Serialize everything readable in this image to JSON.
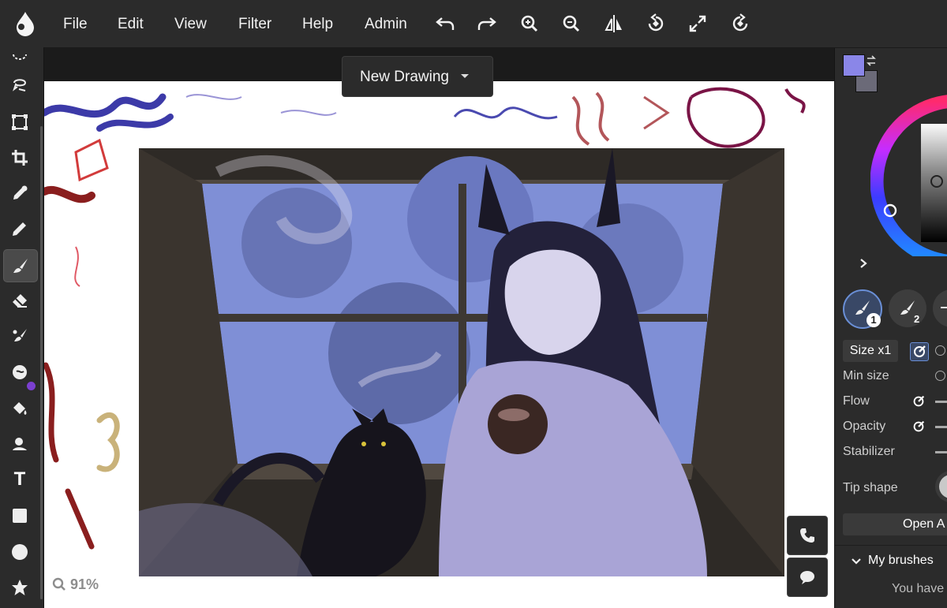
{
  "menu": {
    "items": [
      "File",
      "Edit",
      "View",
      "Filter",
      "Help",
      "Admin"
    ]
  },
  "toolbar_icons": [
    "undo-icon",
    "redo-icon",
    "zoom-in-icon",
    "zoom-out-icon",
    "flip-icon",
    "rotate-ccw-icon",
    "fullscreen-icon",
    "rotate-cw-icon"
  ],
  "left_tools": [
    "select-icon",
    "lasso-icon",
    "transform-icon",
    "crop-icon",
    "eyedropper-icon",
    "pencil-icon",
    "brush-icon",
    "eraser-icon",
    "blend-icon",
    "smudge-icon",
    "fill-icon",
    "stamp-icon",
    "text-icon",
    "rectangle-icon",
    "ellipse-icon",
    "shape-icon"
  ],
  "document": {
    "title": "New Drawing"
  },
  "status": {
    "zoom": "91%"
  },
  "colors": {
    "primary": "#8a86e8",
    "secondary": "#6b6a78",
    "accent": "#6a8fd6"
  },
  "brushes": {
    "slots": [
      {
        "num": "1"
      },
      {
        "num": "2"
      }
    ],
    "size_label": "Size x1",
    "props": {
      "min_size": "Min size",
      "flow": "Flow",
      "opacity": "Opacity",
      "stabilizer": "Stabilizer",
      "tip_shape": "Tip shape"
    },
    "open_label": "Open A",
    "section_title": "My brushes",
    "section_desc": "You have"
  }
}
